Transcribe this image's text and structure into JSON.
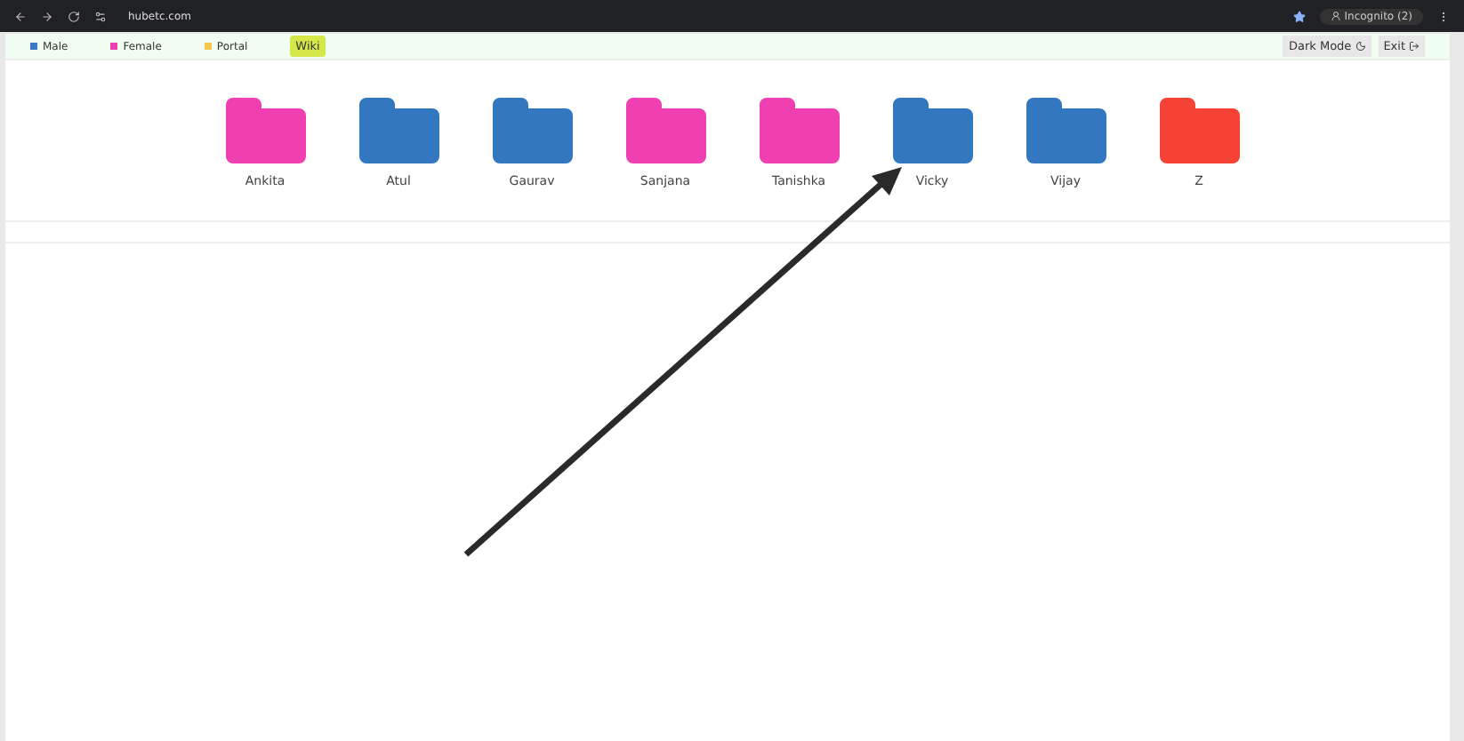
{
  "browser": {
    "url": "hubetc.com",
    "profile": "Incognito (2)"
  },
  "legend": [
    {
      "label": "Male",
      "color": "#3a78c8"
    },
    {
      "label": "Female",
      "color": "#f03fb0"
    },
    {
      "label": "Portal",
      "color": "#f5c84a"
    }
  ],
  "wiki": "Wiki",
  "actions": [
    {
      "label": "Dark Mode",
      "kind": "moon"
    },
    {
      "label": "Exit",
      "kind": "exit"
    }
  ],
  "folders": [
    {
      "name": "Ankita",
      "color": "#f03fb0"
    },
    {
      "name": "Atul",
      "color": "#3277c0"
    },
    {
      "name": "Gaurav",
      "color": "#3277c0"
    },
    {
      "name": "Sanjana",
      "color": "#f03fb0"
    },
    {
      "name": "Tanishka",
      "color": "#f03fb0"
    },
    {
      "name": "Vicky",
      "color": "#3277c0"
    },
    {
      "name": "Vijay",
      "color": "#3277c0"
    },
    {
      "name": "Z",
      "color": "#f44336"
    }
  ]
}
